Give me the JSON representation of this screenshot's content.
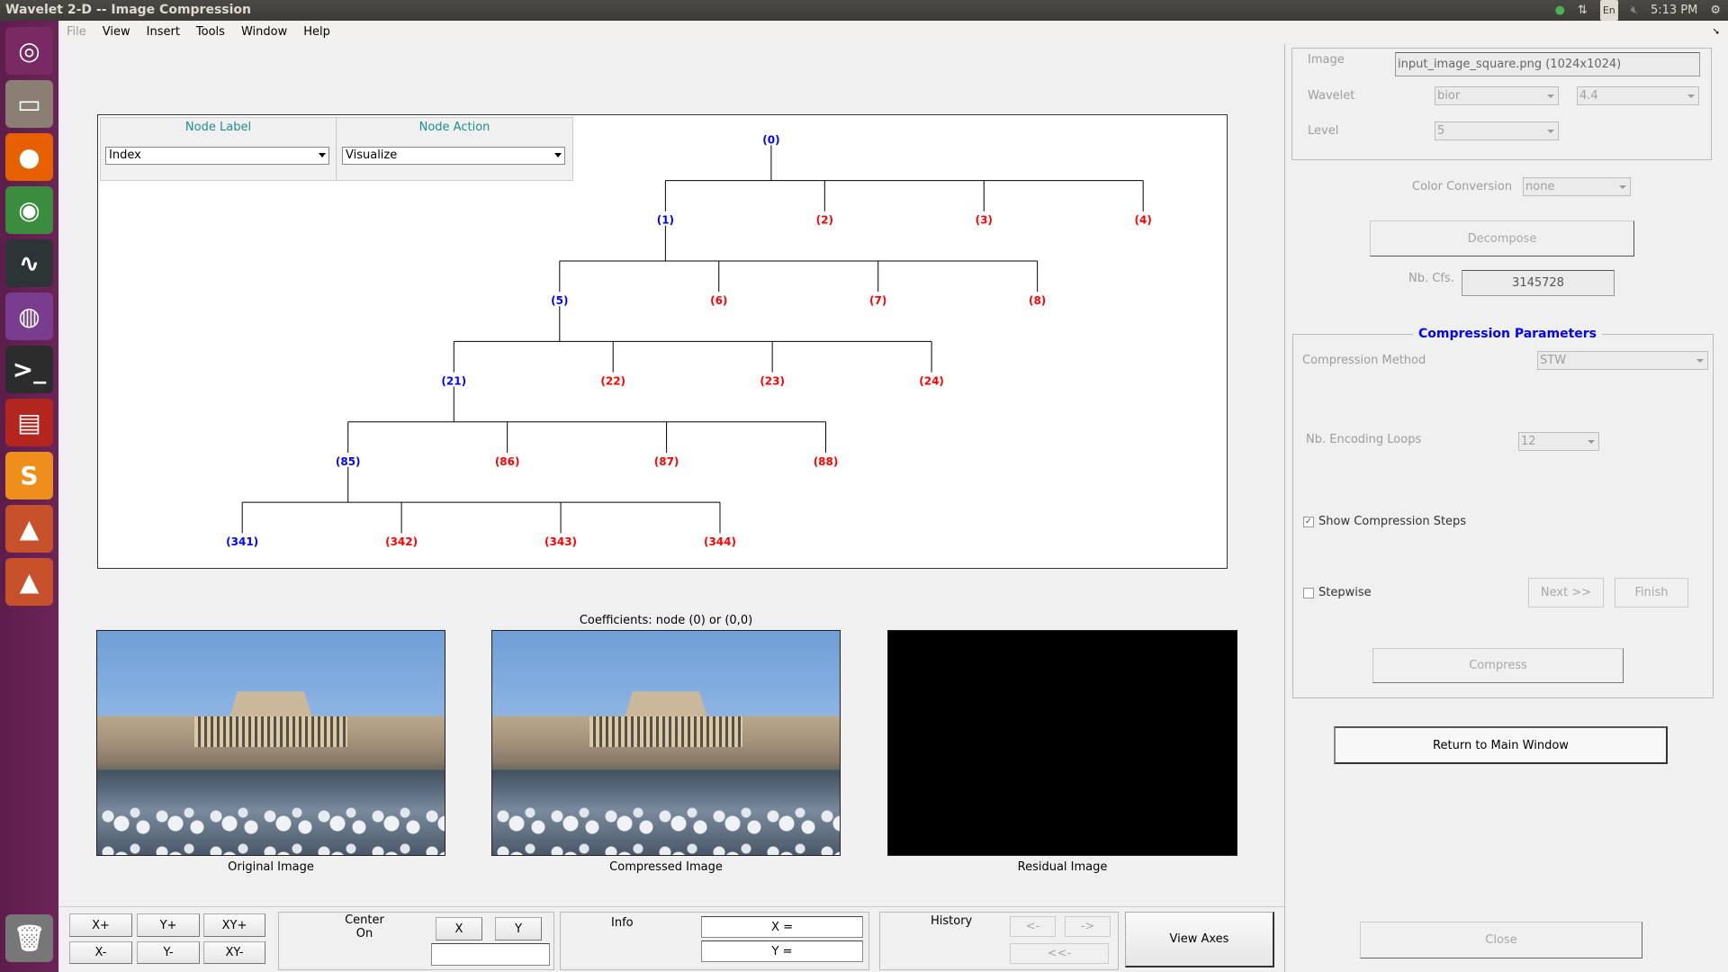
{
  "window": {
    "title": "Wavelet 2-D -- Image Compression"
  },
  "tray": {
    "lang": "En",
    "time": "5:13 PM"
  },
  "menu": [
    "File",
    "View",
    "Insert",
    "Tools",
    "Window",
    "Help"
  ],
  "launcher": [
    {
      "name": "ubuntu-dash-icon",
      "glyph": "◎",
      "color": "#7a2a63"
    },
    {
      "name": "files-icon",
      "glyph": "▭",
      "color": "#8a7f72"
    },
    {
      "name": "firefox-icon",
      "glyph": "●",
      "color": "#e66000"
    },
    {
      "name": "chrome-icon",
      "glyph": "◉",
      "color": "#3b8c3f"
    },
    {
      "name": "system-monitor-icon",
      "glyph": "∿",
      "color": "#2d3436"
    },
    {
      "name": "obs-icon",
      "glyph": "◍",
      "color": "#7a3c8e"
    },
    {
      "name": "terminal-icon",
      "glyph": ">_",
      "color": "#2c2c2c"
    },
    {
      "name": "presentation-icon",
      "glyph": "▤",
      "color": "#b3261e"
    },
    {
      "name": "sublime-text-icon",
      "glyph": "S",
      "color": "#ef8f1b"
    },
    {
      "name": "matlab-icon",
      "glyph": "▲",
      "color": "#c7512a"
    },
    {
      "name": "matlab-icon-2",
      "glyph": "▲",
      "color": "#c7512a"
    }
  ],
  "trash": {
    "glyph": "🗑"
  },
  "tree_panel": {
    "node_label_title": "Node Label",
    "node_label_value": "Index",
    "node_action_title": "Node Action",
    "node_action_value": "Visualize"
  },
  "tree": {
    "root": 0,
    "expanded": [
      0,
      1,
      5,
      21,
      85
    ],
    "selected": [
      0,
      1,
      5,
      21,
      85,
      341
    ],
    "colors": {
      "selected": "#0000ff",
      "leaf": "#ff0000"
    }
  },
  "images": {
    "title": "Coefficients: node (0) or (0,0)",
    "original": "Original Image",
    "compressed": "Compressed Image",
    "residual": "Residual Image"
  },
  "bottom": {
    "xplus": "X+",
    "yplus": "Y+",
    "xyplus": "XY+",
    "xminus": "X-",
    "yminus": "Y-",
    "xyminus": "XY-",
    "center_on": "Center\nOn",
    "center_x": "X",
    "center_y": "Y",
    "center_value": "",
    "info": "Info",
    "info_x": "X =",
    "info_y": "Y =",
    "history": "History",
    "back": "<-",
    "forward": "->",
    "first": "<<-",
    "view_axes": "View Axes"
  },
  "right": {
    "image_label": "Image",
    "image_value": "input_image_square.png  (1024x1024)",
    "wavelet_label": "Wavelet",
    "wavelet_family": "bior",
    "wavelet_number": "4.4",
    "level_label": "Level",
    "level_value": "5",
    "color_conv_label": "Color Conversion",
    "color_conv_value": "none",
    "decompose": "Decompose",
    "nbcfs_label": "Nb. Cfs.",
    "nbcfs_value": "3145728",
    "comp_title": "Compression Parameters",
    "method_label": "Compression Method",
    "method_value": "STW",
    "loops_label": "Nb. Encoding Loops",
    "loops_value": "12",
    "show_steps": "Show Compression Steps",
    "show_steps_checked": true,
    "stepwise": "Stepwise",
    "stepwise_checked": false,
    "next": "Next >>",
    "finish": "Finish",
    "compress": "Compress",
    "return": "Return to Main Window",
    "close": "Close"
  }
}
